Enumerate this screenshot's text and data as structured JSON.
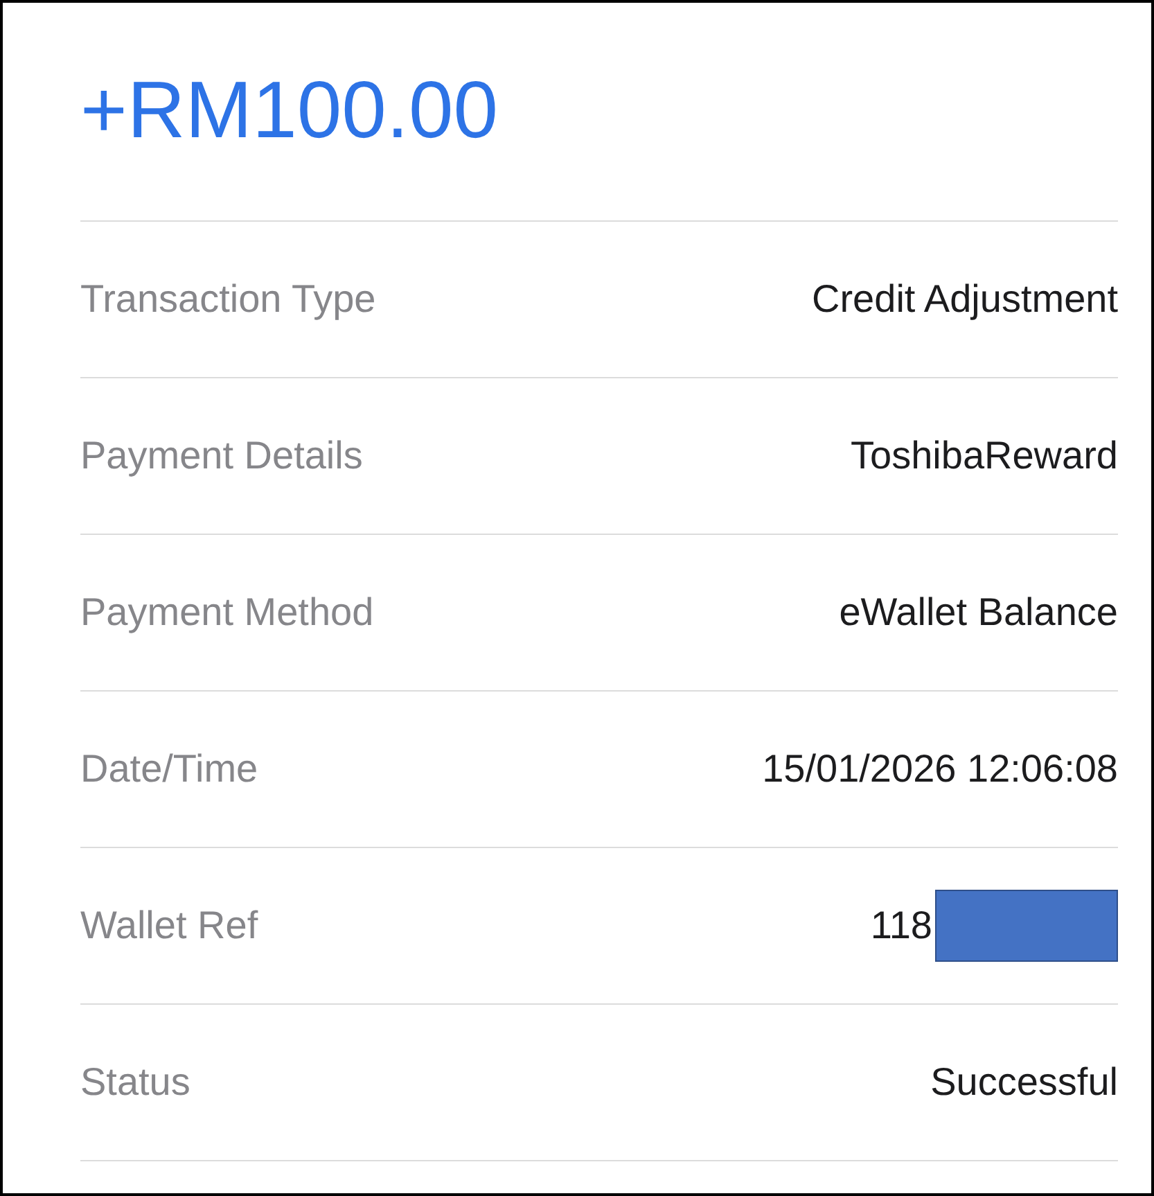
{
  "amount": "+RM100.00",
  "rows": [
    {
      "label": "Transaction Type",
      "value": "Credit Adjustment",
      "redacted": false
    },
    {
      "label": "Payment Details",
      "value": "ToshibaReward",
      "redacted": false
    },
    {
      "label": "Payment Method",
      "value": "eWallet Balance",
      "redacted": false
    },
    {
      "label": "Date/Time",
      "value": "15/01/2026 12:06:08",
      "redacted": false
    },
    {
      "label": "Wallet Ref",
      "value": "118",
      "redacted": true
    },
    {
      "label": "Status",
      "value": "Successful",
      "redacted": false
    }
  ]
}
